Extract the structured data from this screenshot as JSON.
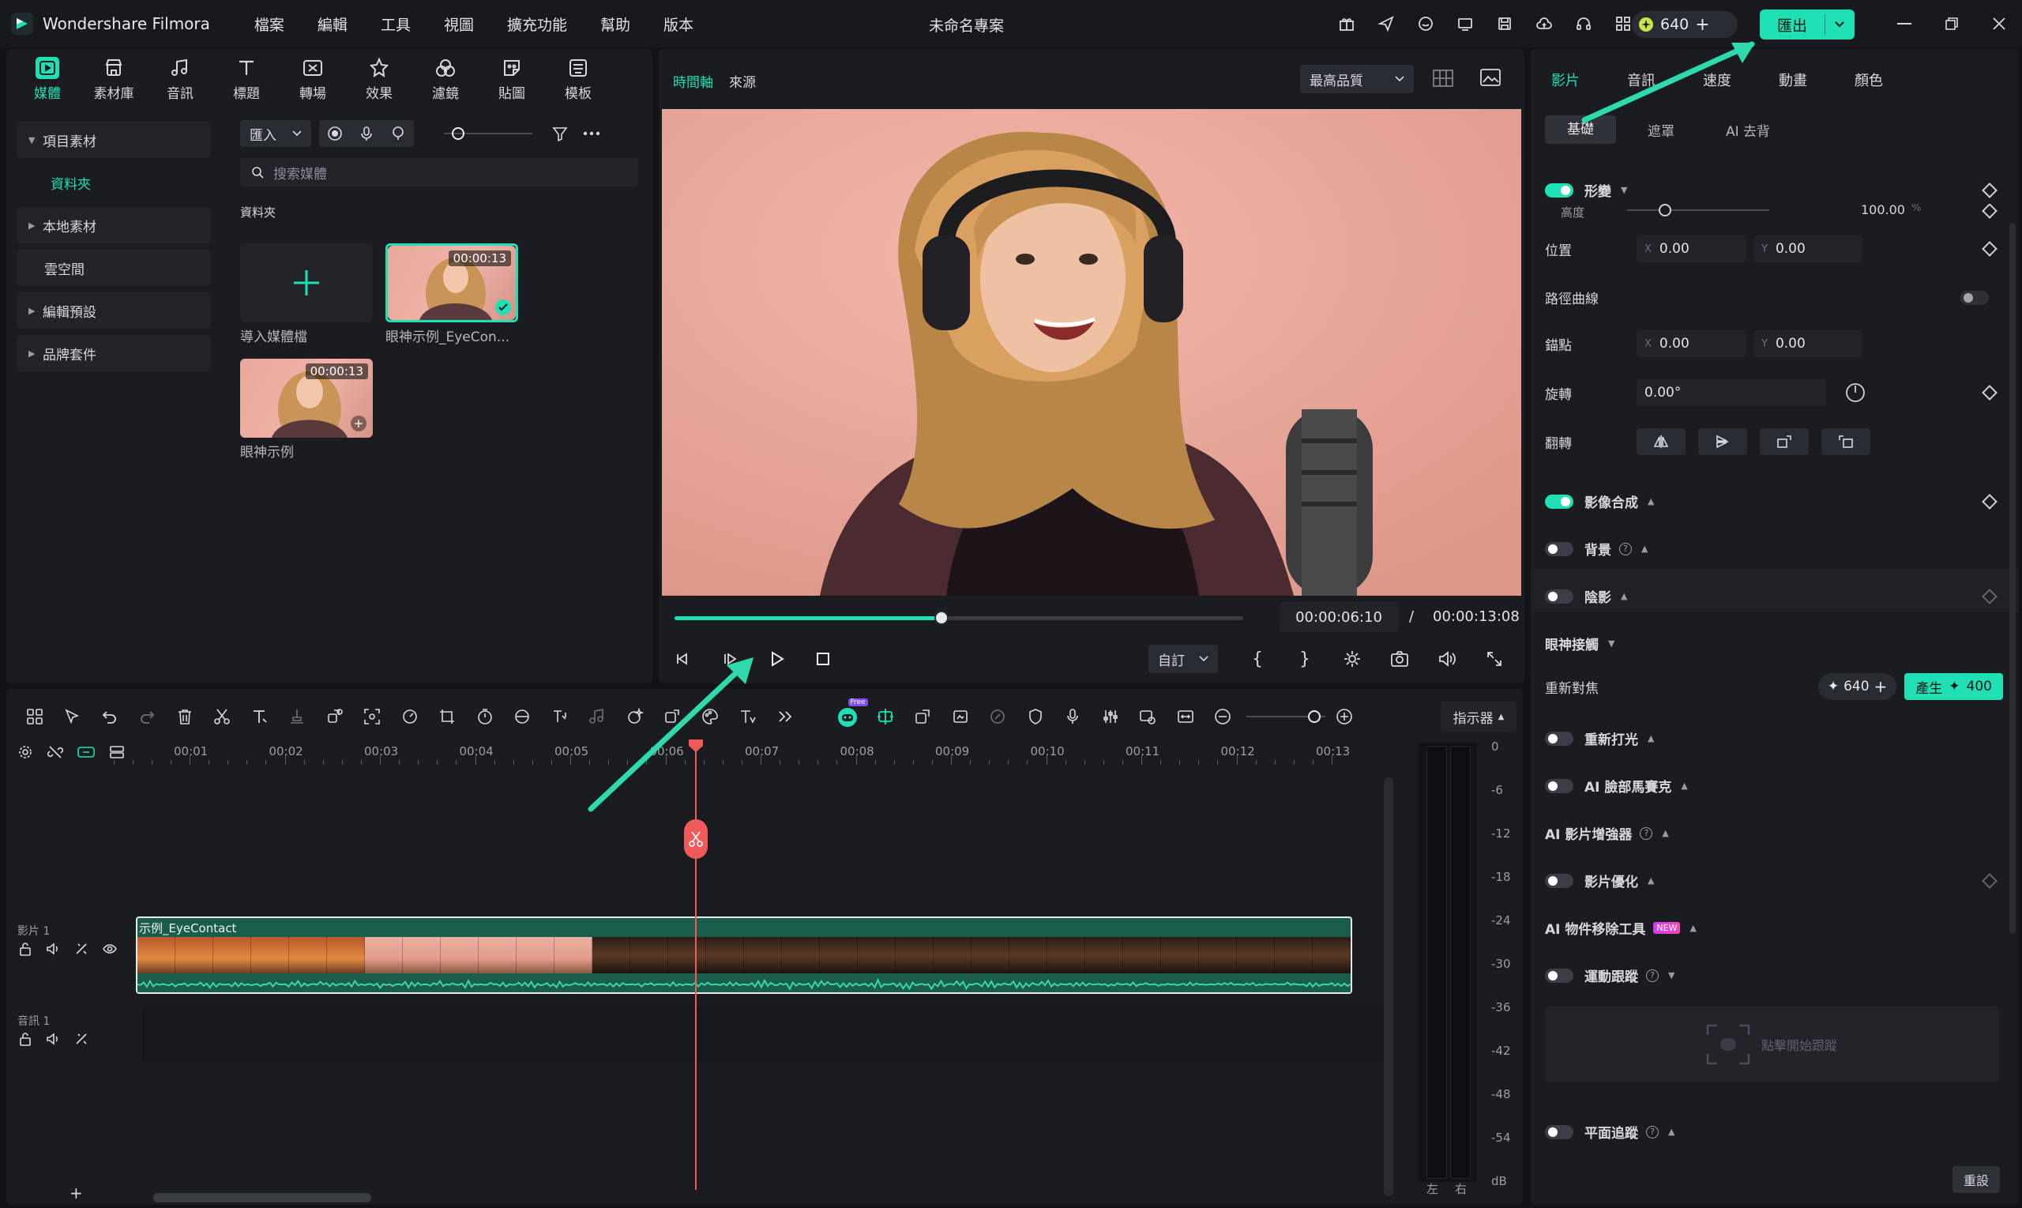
{
  "titlebar": {
    "app_name": "Wondershare Filmora",
    "menus": [
      "檔案",
      "編輯",
      "工具",
      "視圖",
      "擴充功能",
      "幫助",
      "版本"
    ],
    "project_name": "未命名專案",
    "credits": "640",
    "export_label": "匯出"
  },
  "media": {
    "tabs": [
      {
        "label": "媒體",
        "icon": "media-icon"
      },
      {
        "label": "素材庫",
        "icon": "stock-icon"
      },
      {
        "label": "音訊",
        "icon": "music-icon"
      },
      {
        "label": "標題",
        "icon": "title-icon"
      },
      {
        "label": "轉場",
        "icon": "transition-icon"
      },
      {
        "label": "效果",
        "icon": "effects-icon"
      },
      {
        "label": "濾鏡",
        "icon": "filters-icon"
      },
      {
        "label": "貼圖",
        "icon": "stickers-icon"
      },
      {
        "label": "模板",
        "icon": "templates-icon"
      }
    ],
    "sidebar": {
      "project_media": "項目素材",
      "folder": "資料夾",
      "local_media": "本地素材",
      "cloud": "雲空間",
      "presets": "編輯預設",
      "brand_kit": "品牌套件"
    },
    "import_label": "匯入",
    "search_placeholder": "搜索媒體",
    "folder_heading": "資料夾",
    "import_tile_label": "導入媒體檔",
    "clips": [
      {
        "label": "眼神示例_EyeCon...",
        "duration": "00:00:13"
      },
      {
        "label": "眼神示例",
        "duration": "00:00:13"
      }
    ]
  },
  "preview": {
    "tab_timeline": "時間軸",
    "tab_source": "來源",
    "quality": "最高品質",
    "current_time": "00:00:06:10",
    "separator": "/",
    "total_time": "00:00:13:08",
    "progress": 0.47,
    "fit": "自訂",
    "bracket_in": "{",
    "bracket_out": "}"
  },
  "properties": {
    "tabs": [
      "影片",
      "音訊",
      "速度",
      "動畫",
      "顏色"
    ],
    "subtabs": [
      "基礎",
      "遮罩",
      "AI 去背"
    ],
    "transform": "形變",
    "height_label": "高度",
    "height_value": "100.00",
    "height_unit": "%",
    "position": "位置",
    "pos_x": "0.00",
    "pos_y": "0.00",
    "path_curve": "路徑曲線",
    "anchor": "錨點",
    "anchor_x": "0.00",
    "anchor_y": "0.00",
    "rotate": "旋轉",
    "rotate_value": "0.00°",
    "flip": "翻轉",
    "compositing": "影像合成",
    "background": "背景",
    "shadow": "陰影",
    "eye_contact": "眼神接觸",
    "refocus": "重新對焦",
    "refocus_credit": "640",
    "generate_label": "產生",
    "generate_credit": "400",
    "relight": "重新打光",
    "face_mosaic": "AI 臉部馬賽克",
    "enhancer": "AI 影片增強器",
    "optimize": "影片優化",
    "object_remover": "AI 物件移除工具",
    "new_tag": "NEW",
    "motion_tracking": "運動跟蹤",
    "tracking_hint": "點擊開始跟蹤",
    "planar_tracking": "平面追蹤",
    "reset": "重設",
    "x_axis": "X",
    "y_axis": "Y"
  },
  "timeline": {
    "marker_label": "指示器",
    "ticks": [
      "00:01",
      "00:02",
      "00:03",
      "00:04",
      "00:05",
      "00:06",
      "00:07",
      "00:08",
      "00:09",
      "00:10",
      "00:11",
      "00:12",
      "00:13"
    ],
    "video_track": "影片 1",
    "audio_track": "音訊 1",
    "clip_title": "示例_EyeContact",
    "playhead_time_sec": 6.42,
    "db_scale": [
      "0",
      "-6",
      "-12",
      "-18",
      "-24",
      "-30",
      "-36",
      "-42",
      "-48",
      "-54",
      "dB"
    ],
    "meter_left": "左",
    "meter_right": "右",
    "add_track": "+",
    "free_badge": "Free"
  },
  "colors": {
    "accent": "#1fe0b4",
    "playhead": "#f05a5a",
    "panel": "#1b1c20",
    "background": "#121316"
  }
}
